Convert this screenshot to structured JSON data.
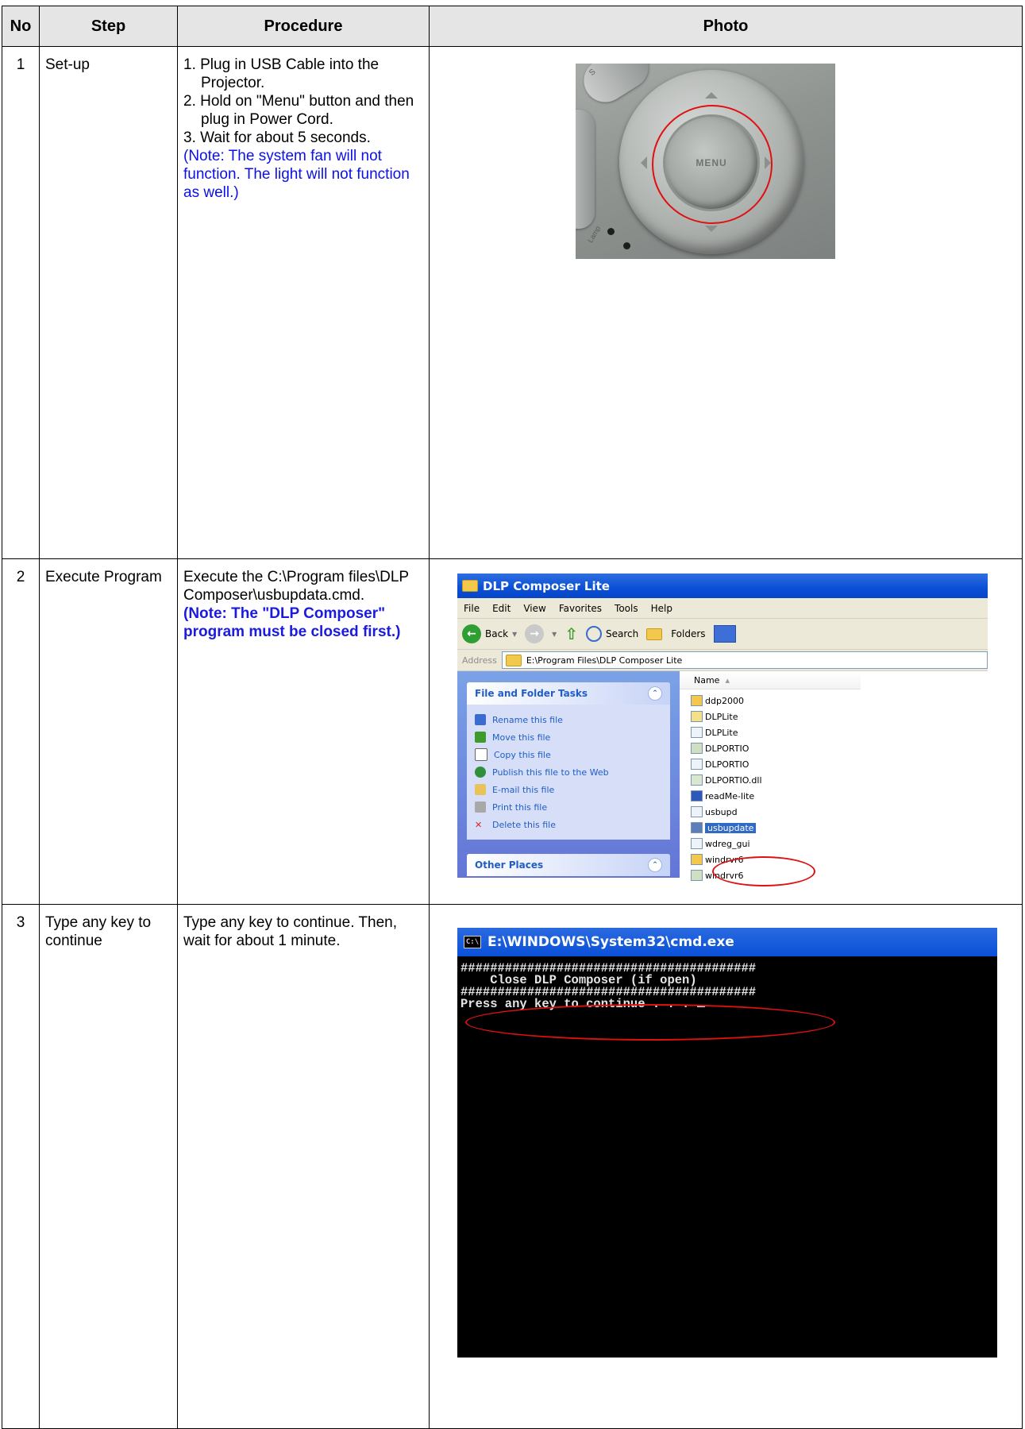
{
  "table": {
    "headers": {
      "no": "No",
      "step": "Step",
      "procedure": "Procedure",
      "photo": "Photo"
    },
    "rows": [
      {
        "no": "1",
        "step": "Set-up",
        "procedure": [
          "1. Plug in USB Cable into the Projector.",
          "2. Hold on \"Menu\" button and then plug in Power Cord.",
          "3. Wait for about 5 seconds."
        ],
        "note": "(Note: The system fan will not function.  The light will not function as well.)"
      },
      {
        "no": "2",
        "step": "Execute Program",
        "procedure": "Execute the C:\\Program files\\DLP Composer\\usbupdata.cmd.",
        "note": "(Note: The \"DLP Composer\" program must be closed first.)"
      },
      {
        "no": "3",
        "step": "Type any key to continue",
        "procedure": "Type any key to continue. Then, wait for about 1 minute."
      }
    ]
  },
  "photo1": {
    "menu_label": "MENU",
    "side_label": "S",
    "lamp_label": "Lamp"
  },
  "explorer": {
    "title": "DLP Composer Lite",
    "menu": [
      "File",
      "Edit",
      "View",
      "Favorites",
      "Tools",
      "Help"
    ],
    "toolbar": {
      "back": "Back",
      "search": "Search",
      "folders": "Folders"
    },
    "address_label": "Address",
    "address": "E:\\Program Files\\DLP Composer Lite",
    "tasks_title": "File and Folder Tasks",
    "tasks": [
      {
        "label": "Rename this file",
        "icon": "rename-icon",
        "color": "#3a6bd0"
      },
      {
        "label": "Move this file",
        "icon": "move-icon",
        "color": "#3e9a2b"
      },
      {
        "label": "Copy this file",
        "icon": "copy-icon",
        "color": "#ffffff"
      },
      {
        "label": "Publish this file to the Web",
        "icon": "globe-icon",
        "color": "#2f8f3a"
      },
      {
        "label": "E-mail this file",
        "icon": "mail-icon",
        "color": "#e8c35a"
      },
      {
        "label": "Print this file",
        "icon": "printer-icon",
        "color": "#a8a8a8"
      },
      {
        "label": "Delete this file",
        "icon": "delete-icon",
        "color": "#e02020"
      }
    ],
    "other_places": "Other Places",
    "name_column": "Name",
    "files": [
      {
        "name": "ddp2000",
        "selected": false
      },
      {
        "name": "DLPLite",
        "selected": false
      },
      {
        "name": "DLPLite",
        "selected": false
      },
      {
        "name": "DLPORTIO",
        "selected": false
      },
      {
        "name": "DLPORTIO",
        "selected": false
      },
      {
        "name": "DLPORTIO.dll",
        "selected": false
      },
      {
        "name": "readMe-lite",
        "selected": false
      },
      {
        "name": "usbupd",
        "selected": false
      },
      {
        "name": "usbupdate",
        "selected": true
      },
      {
        "name": "wdreg_gui",
        "selected": false
      },
      {
        "name": "windrvr6",
        "selected": false
      },
      {
        "name": "windrvr6",
        "selected": false
      }
    ]
  },
  "cmd": {
    "title": "E:\\WINDOWS\\System32\\cmd.exe",
    "icon_text": "C:\\",
    "lines": [
      "########################################",
      "    Close DLP Composer (if open)",
      "########################################",
      "Press any key to continue . . . "
    ]
  },
  "colors": {
    "note_blue": "#0b10e6",
    "highlight_red": "#e01010",
    "xp_blue": "#0a4fd6"
  }
}
